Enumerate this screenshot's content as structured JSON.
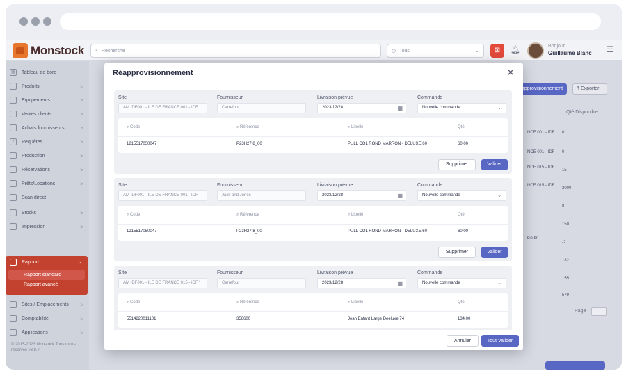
{
  "app": {
    "logo_text": "Monstock",
    "search_placeholder": "Recherche",
    "store_select": "Tous",
    "user_greeting": "Bonjour",
    "user_name": "Guillaume Blanc",
    "colors": {
      "accent": "#5866c4",
      "brand": "#e8772e",
      "active_menu": "#c2422f"
    }
  },
  "sidebar": {
    "items": [
      {
        "label": "Tableau de bord",
        "icon": "dashboard-icon",
        "arrow": ""
      },
      {
        "label": "Produits",
        "icon": "box-icon",
        "arrow": ">"
      },
      {
        "label": "Equipements",
        "icon": "wrench-icon",
        "arrow": ">"
      },
      {
        "label": "Ventes clients",
        "icon": "cart-icon",
        "arrow": ">"
      },
      {
        "label": "Achats fournisseurs",
        "icon": "truck-icon",
        "arrow": ">"
      },
      {
        "label": "Requêtes",
        "icon": "question-icon",
        "arrow": ">"
      },
      {
        "label": "Production",
        "icon": "factory-icon",
        "arrow": ">"
      },
      {
        "label": "Réservations",
        "icon": "calendar-icon",
        "arrow": ">"
      },
      {
        "label": "Prêts/Locations",
        "icon": "key-icon",
        "arrow": ">"
      },
      {
        "label": "Scan direct",
        "icon": "scan-icon",
        "arrow": ""
      },
      {
        "label": "Stocks",
        "icon": "stock-icon",
        "arrow": ">"
      },
      {
        "label": "Impression",
        "icon": "print-icon",
        "arrow": ">"
      }
    ],
    "active": {
      "label": "Rapport",
      "sub_items": [
        "Rapport standard",
        "Rapport avancé"
      ]
    },
    "items_after": [
      {
        "label": "Sites / Emplacements",
        "icon": "location-icon",
        "arrow": ">"
      },
      {
        "label": "Comptabilité",
        "icon": "calculator-icon",
        "arrow": ">"
      },
      {
        "label": "Applications",
        "icon": "apps-icon",
        "arrow": ">"
      }
    ],
    "copyright": "© 2015-2023 Monstock Tous droits réservés v3.8.7"
  },
  "background": {
    "btn_primary": "Réapprovisionnement",
    "btn_export": "Exporter",
    "qte_header": "Qté Disponible",
    "rows": [
      {
        "site": "NCE 001 - IDF",
        "qte": "0"
      },
      {
        "site": "NCE 001 - IDF",
        "qte": "0"
      },
      {
        "site": "NCE 015 - IDF",
        "qte": "15"
      },
      {
        "site": "NCE 015 - IDF",
        "qte": "2000"
      },
      {
        "site": "",
        "qte": "8"
      },
      {
        "site": "",
        "qte": "150"
      },
      {
        "site": "bie bn",
        "qte": "-2"
      },
      {
        "site": "",
        "qte": "182"
      },
      {
        "site": "",
        "qte": "155"
      },
      {
        "site": "",
        "qte": "579"
      }
    ],
    "page_label": "Page"
  },
  "modal": {
    "title": "Réapprovisionnement",
    "labels": {
      "site": "Site",
      "fournisseur": "Fournisseur",
      "livraison": "Livraison prévue",
      "commande": "Commande"
    },
    "columns": {
      "code": "Code",
      "reference": "Référence",
      "libelle": "Libellé",
      "qte": "Qté"
    },
    "btn_supprimer": "Supprimer",
    "btn_valider": "Valider",
    "blocks": [
      {
        "site": "AM IDF001 - ILE DE FRANCE 001 - IDF",
        "fournisseur": "Carrefour",
        "livraison": "2023/12/28",
        "commande": "Nouvelle commande",
        "row": {
          "code": "1215517050047",
          "reference": "P23H27I8_00",
          "libelle": "PULL COL ROND MARRON - DELUXE 60",
          "qte": "60,00"
        }
      },
      {
        "site": "AM IDF001 - ILE DE FRANCE 001 - IDF",
        "fournisseur": "Jack and Jones",
        "livraison": "2023/12/28",
        "commande": "Nouvelle commande",
        "row": {
          "code": "1215517050047",
          "reference": "P23H27I8_00",
          "libelle": "PULL COL ROND MARRON - DELUXE 60",
          "qte": "60,00"
        }
      },
      {
        "site": "AM IDF001 - ILE DE FRANCE 015 - IDF \\",
        "fournisseur": "Carrefour",
        "livraison": "2023/12/28",
        "commande": "Nouvelle commande",
        "row": {
          "code": "5514220011101",
          "reference": "356600",
          "libelle": "Jean Enfant Large Deeluxe 74",
          "qte": "134,00"
        }
      }
    ],
    "footer": {
      "annuler": "Annuler",
      "tout_valider": "Tout Valider"
    }
  }
}
